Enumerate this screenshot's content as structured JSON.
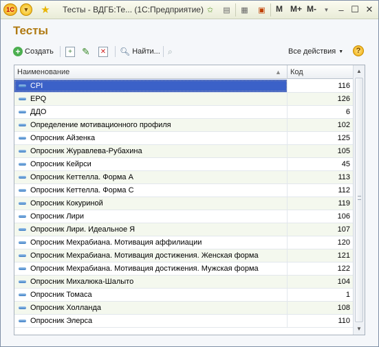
{
  "titlebar": {
    "logo": "1С",
    "title": "Тесты - ВДГБ:Те...  (1С:Предприятие)",
    "mem_m": "M",
    "mem_mplus": "M+",
    "mem_mminus": "M-",
    "icons": [
      "app-menu-icon",
      "favorite-star-icon",
      "add-favorite-icon",
      "print-icon",
      "calculator-icon",
      "calendar-icon",
      "minimize-icon",
      "maximize-icon",
      "close-icon"
    ]
  },
  "form": {
    "title": "Тесты"
  },
  "toolbar": {
    "create_label": "Создать",
    "find_label": "Найти...",
    "all_actions_label": "Все действия",
    "help_label": "?"
  },
  "table": {
    "columns": [
      "Наименование",
      "Код"
    ],
    "rows": [
      {
        "name": "CPI",
        "code": "116",
        "selected": true
      },
      {
        "name": "EPQ",
        "code": "126"
      },
      {
        "name": "ДДО",
        "code": "6"
      },
      {
        "name": "Определение мотивационного профиля",
        "code": "102"
      },
      {
        "name": "Опросник Айзенка",
        "code": "125"
      },
      {
        "name": "Опросник Журавлева-Рубахина",
        "code": "105"
      },
      {
        "name": "Опросник Кейрси",
        "code": "45"
      },
      {
        "name": "Опросник Кеттелла. Форма А",
        "code": "113"
      },
      {
        "name": "Опросник Кеттелла. Форма С",
        "code": "112"
      },
      {
        "name": "Опросник Кокуриной",
        "code": "119"
      },
      {
        "name": "Опросник Лири",
        "code": "106"
      },
      {
        "name": "Опросник Лири. Идеальное Я",
        "code": "107"
      },
      {
        "name": "Опросник Мехрабиана. Мотивация аффилиации",
        "code": "120"
      },
      {
        "name": "Опросник Мехрабиана. Мотивация достижения. Женская форма",
        "code": "121"
      },
      {
        "name": "Опросник Мехрабиана. Мотивация достижения. Мужская форма",
        "code": "122"
      },
      {
        "name": "Опросник Михалюка-Шалыто",
        "code": "104"
      },
      {
        "name": "Опросник Томаса",
        "code": "1"
      },
      {
        "name": "Опросник Холланда",
        "code": "108"
      },
      {
        "name": "Опросник Элерса",
        "code": "110"
      }
    ]
  }
}
